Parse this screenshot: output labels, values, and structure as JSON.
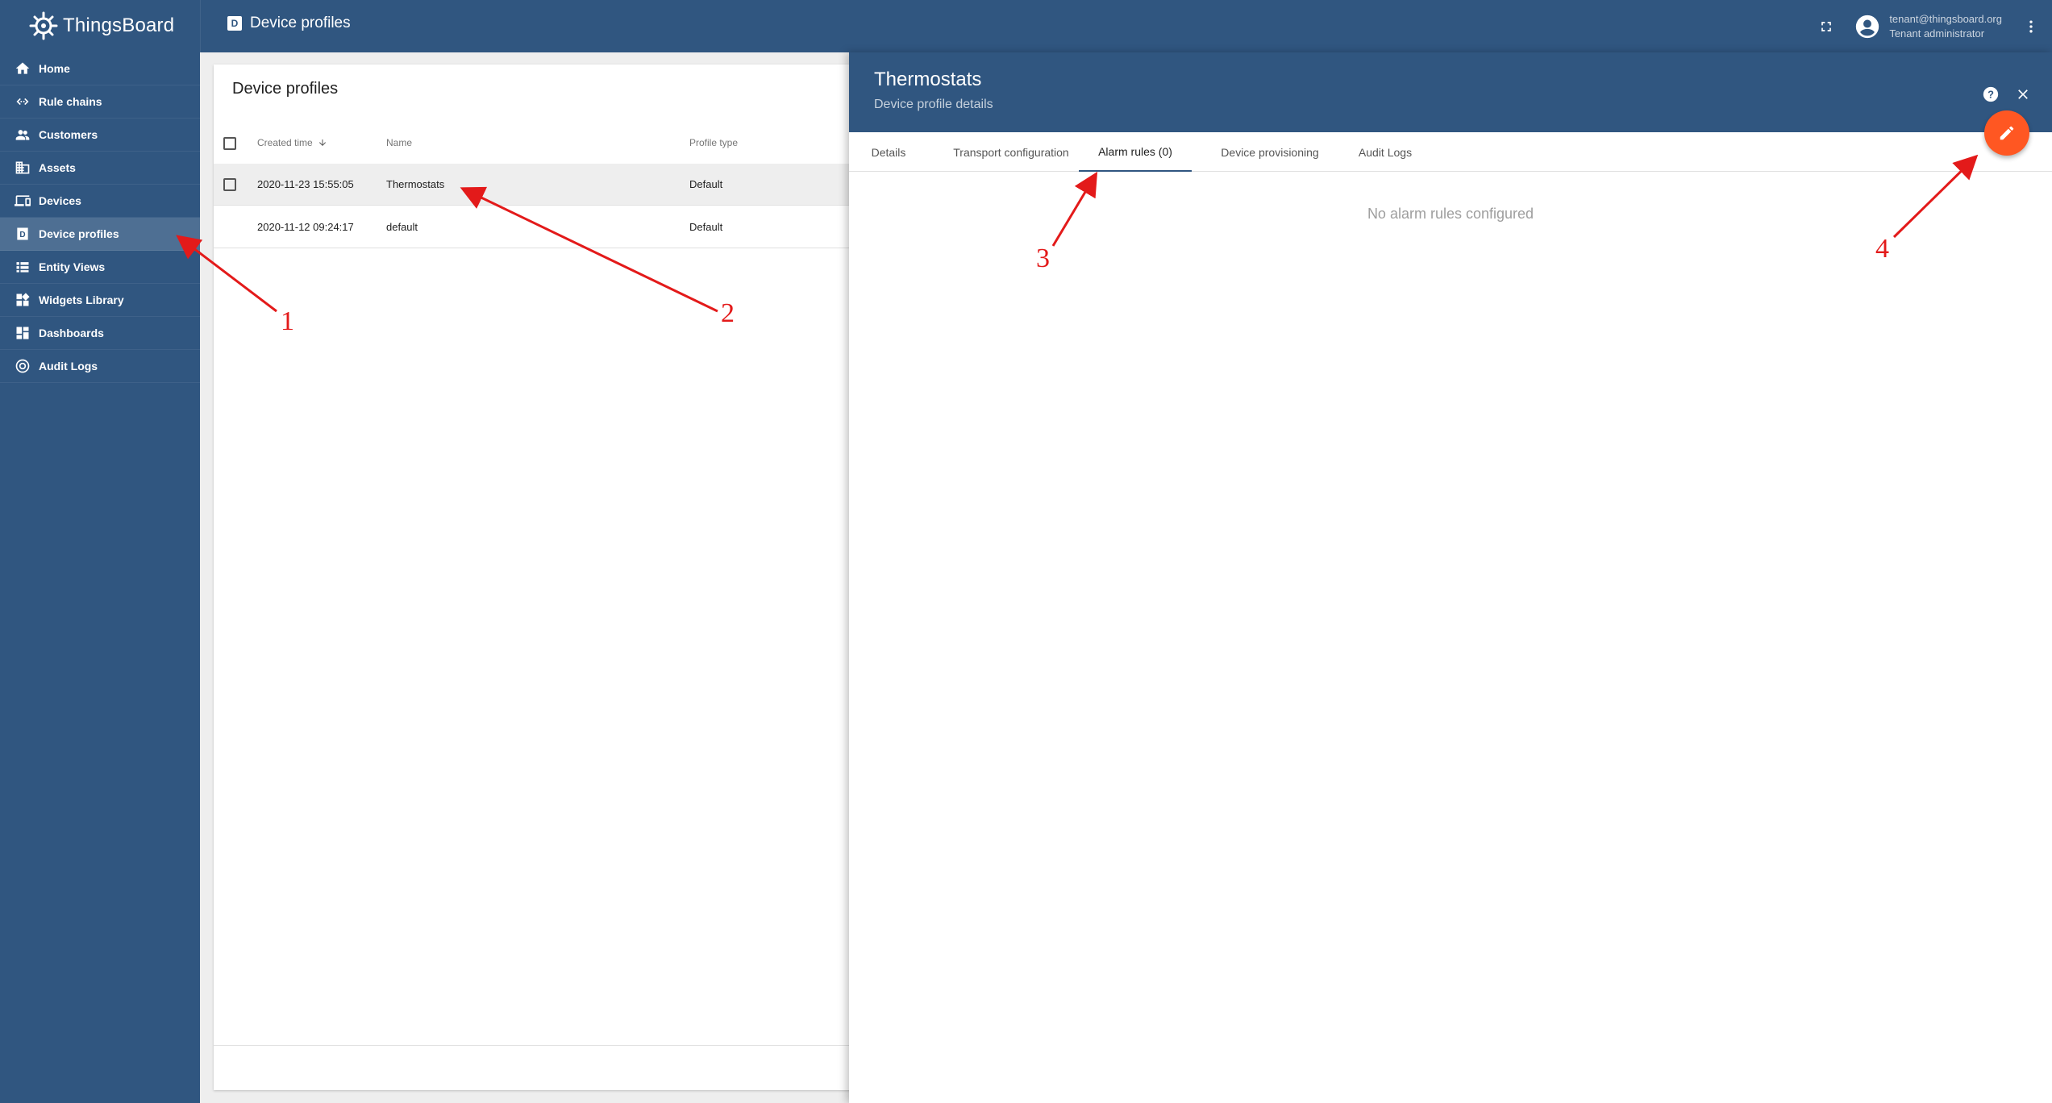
{
  "app": {
    "name": "ThingsBoard"
  },
  "breadcrumb": {
    "label": "Device profiles",
    "icon": "device-profile-icon"
  },
  "user": {
    "email": "tenant@thingsboard.org",
    "role": "Tenant administrator"
  },
  "sidebar": {
    "items": [
      {
        "label": "Home",
        "icon": "home-icon"
      },
      {
        "label": "Rule chains",
        "icon": "rule-chains-icon"
      },
      {
        "label": "Customers",
        "icon": "customers-icon"
      },
      {
        "label": "Assets",
        "icon": "assets-icon"
      },
      {
        "label": "Devices",
        "icon": "devices-icon"
      },
      {
        "label": "Device profiles",
        "icon": "device-profile-icon"
      },
      {
        "label": "Entity Views",
        "icon": "entity-views-icon"
      },
      {
        "label": "Widgets Library",
        "icon": "widgets-icon"
      },
      {
        "label": "Dashboards",
        "icon": "dashboards-icon"
      },
      {
        "label": "Audit Logs",
        "icon": "audit-logs-icon"
      }
    ]
  },
  "list": {
    "title": "Device profiles",
    "columns": {
      "created": "Created time",
      "name": "Name",
      "type": "Profile type"
    },
    "rows": [
      {
        "created": "2020-11-23 15:55:05",
        "name": "Thermostats",
        "type": "Default"
      },
      {
        "created": "2020-11-12 09:24:17",
        "name": "default",
        "type": "Default"
      }
    ]
  },
  "detail": {
    "title": "Thermostats",
    "subtitle": "Device profile details",
    "tabs": [
      "Details",
      "Transport configuration",
      "Alarm rules (0)",
      "Device provisioning",
      "Audit Logs"
    ],
    "empty_message": "No alarm rules configured"
  },
  "annotations": [
    "1",
    "2",
    "3",
    "4"
  ],
  "colors": {
    "primary": "#305680",
    "accent": "#ff5722",
    "annotation": "#e31a1a"
  }
}
